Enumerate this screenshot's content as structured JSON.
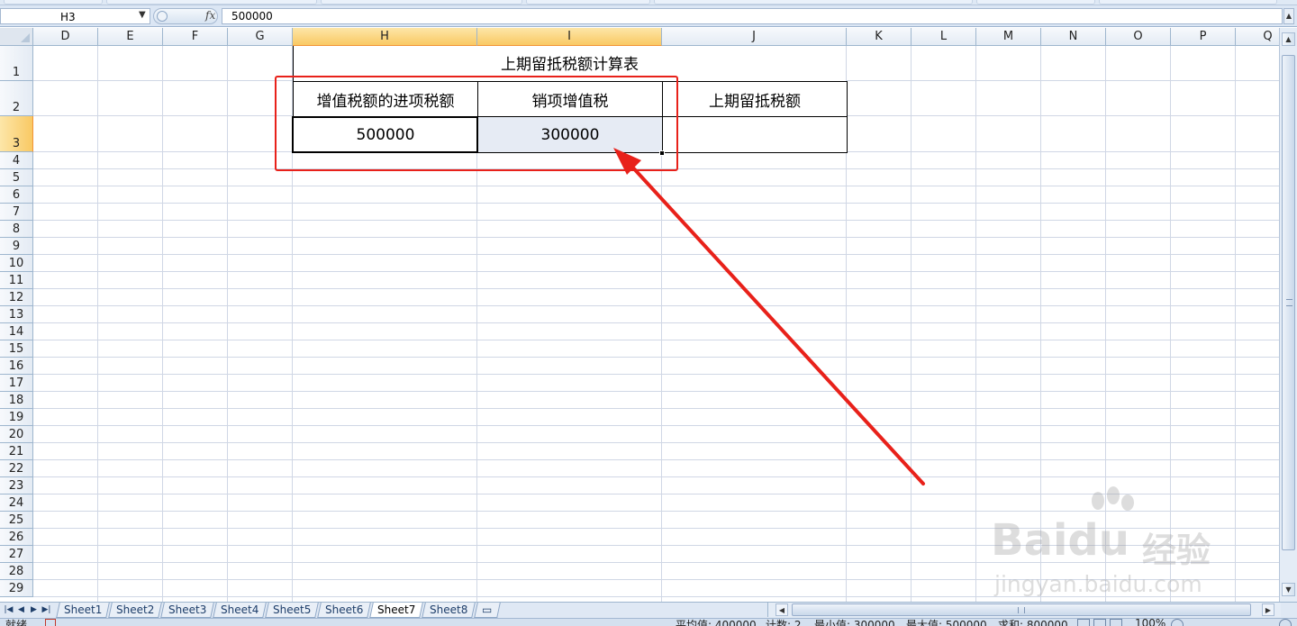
{
  "formula_bar": {
    "name_box": "H3",
    "fx_label": "fx",
    "value": "500000"
  },
  "columns": [
    "D",
    "E",
    "F",
    "G",
    "H",
    "I",
    "J",
    "K",
    "L",
    "M",
    "N",
    "O",
    "P",
    "Q"
  ],
  "rows": [
    "1",
    "2",
    "3",
    "4",
    "5",
    "6",
    "7",
    "8",
    "9",
    "10",
    "11",
    "12",
    "13",
    "14",
    "15",
    "16",
    "17",
    "18",
    "19",
    "20",
    "21",
    "22",
    "23",
    "24",
    "25",
    "26",
    "27",
    "28",
    "29"
  ],
  "table": {
    "title": "上期留抵税额计算表",
    "headers": [
      "增值税额的进项税额",
      "销项增值税",
      "上期留抵税额"
    ],
    "values": [
      "500000",
      "300000",
      ""
    ]
  },
  "watermark": {
    "brand": "Baidu",
    "suffix": "经验",
    "url": "jingyan.baidu.com"
  },
  "sheet_tabs": [
    "Sheet1",
    "Sheet2",
    "Sheet3",
    "Sheet4",
    "Sheet5",
    "Sheet6",
    "Sheet7",
    "Sheet8"
  ],
  "active_sheet": "Sheet7",
  "status_bar": {
    "ready": "就绪",
    "average": "平均值: 400000",
    "count": "计数: 2",
    "min": "最小值: 300000",
    "max": "最大值: 500000",
    "sum": "求和: 800000",
    "zoom": "100%"
  },
  "colors": {
    "annotation_red": "#e8211a",
    "selected_header": "#f9c964",
    "gridline": "#d0d7e5"
  }
}
